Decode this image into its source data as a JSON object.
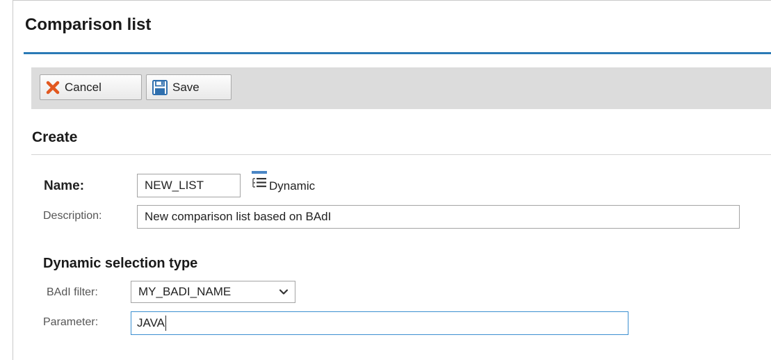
{
  "window": {
    "title": "Comparison list"
  },
  "toolbar": {
    "cancel_label": "Cancel",
    "save_label": "Save"
  },
  "section": {
    "title": "Create"
  },
  "form": {
    "name_label": "Name:",
    "name_value": "NEW_LIST",
    "dynamic_label": "Dynamic",
    "description_label": "Description:",
    "description_value": "New comparison list based on BAdI"
  },
  "selection": {
    "title": "Dynamic selection type",
    "badi_filter_label": "BAdI filter:",
    "badi_filter_value": "MY_BADI_NAME",
    "parameter_label": "Parameter:",
    "parameter_value": "JAVA"
  },
  "icons": {
    "cancel": "close-x-icon",
    "save": "floppy-disk-icon",
    "dynamic": "list-icon",
    "dropdown": "chevron-down-icon"
  },
  "colors": {
    "accent": "#2a7ab6",
    "cancel_x": "#e2581f",
    "save_icon": "#2f6fae",
    "toolbar_bg": "#dcdcdc"
  }
}
